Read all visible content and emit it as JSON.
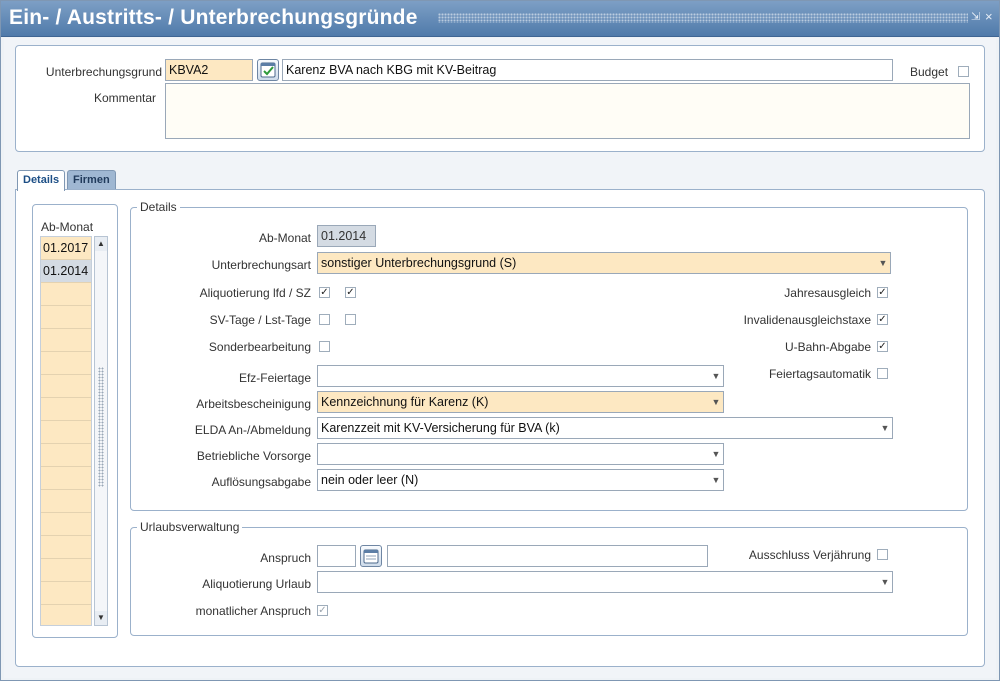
{
  "window": {
    "title": "Ein- / Austritts- / Unterbrechungsgründe",
    "controls": {
      "pin": "⇲",
      "close": "×"
    }
  },
  "header": {
    "unterbrechungsgrund_label": "Unterbrechungsgrund",
    "unterbrechungsgrund_code": "KBVA2",
    "unterbrechungsgrund_text": "Karenz BVA nach KBG mit KV-Beitrag",
    "budget_label": "Budget",
    "budget_checked": false,
    "kommentar_label": "Kommentar",
    "kommentar_value": ""
  },
  "tabs": [
    {
      "label": "Details",
      "active": true
    },
    {
      "label": "Firmen",
      "active": false
    }
  ],
  "ab_monat_list": {
    "header": "Ab-Monat",
    "rows": [
      "01.2017",
      "01.2014",
      "",
      "",
      "",
      "",
      "",
      "",
      "",
      "",
      "",
      "",
      "",
      "",
      "",
      "",
      ""
    ],
    "selected_index": 1
  },
  "details": {
    "legend": "Details",
    "ab_monat_label": "Ab-Monat",
    "ab_monat_value": "01.2014",
    "unterbrechungsart_label": "Unterbrechungsart",
    "unterbrechungsart_value": "sonstiger Unterbrechungsgrund (S)",
    "aliquotierung_label": "Aliquotierung lfd / SZ",
    "aliquotierung_lfd": true,
    "aliquotierung_sz": true,
    "svtage_label": "SV-Tage / Lst-Tage",
    "svtage_sv": false,
    "svtage_lst": false,
    "sonderbearbeitung_label": "Sonderbearbeitung",
    "sonderbearbeitung": false,
    "efz_label": "Efz-Feiertage",
    "efz_value": "",
    "arbeitsbescheinigung_label": "Arbeitsbescheinigung",
    "arbeitsbescheinigung_value": "Kennzeichnung für Karenz (K)",
    "elda_label": "ELDA An-/Abmeldung",
    "elda_value": "Karenzzeit mit KV-Versicherung für BVA (k)",
    "vorsorge_label": "Betriebliche Vorsorge",
    "vorsorge_value": "",
    "aufloesung_label": "Auflösungsabgabe",
    "aufloesung_value": "nein oder leer (N)",
    "jahresausgleich_label": "Jahresausgleich",
    "jahresausgleich": true,
    "invaliden_label": "Invalidenausgleichstaxe",
    "invaliden": true,
    "ubahn_label": "U-Bahn-Abgabe",
    "ubahn": true,
    "feiertagsautomatik_label": "Feiertagsautomatik",
    "feiertagsautomatik": false
  },
  "urlaub": {
    "legend": "Urlaubsverwaltung",
    "anspruch_label": "Anspruch",
    "anspruch_value": "",
    "anspruch_text": "",
    "ausschluss_label": "Ausschluss Verjährung",
    "ausschluss": false,
    "aliquotierung_label": "Aliquotierung Urlaub",
    "aliquotierung_value": "",
    "monatlich_label": "monatlicher Anspruch",
    "monatlich": true
  },
  "colors": {
    "title_bar": "#5f86b3",
    "required_field": "#fde8c2",
    "readonly_field": "#d4dbe3",
    "border": "#9bb1cb"
  }
}
